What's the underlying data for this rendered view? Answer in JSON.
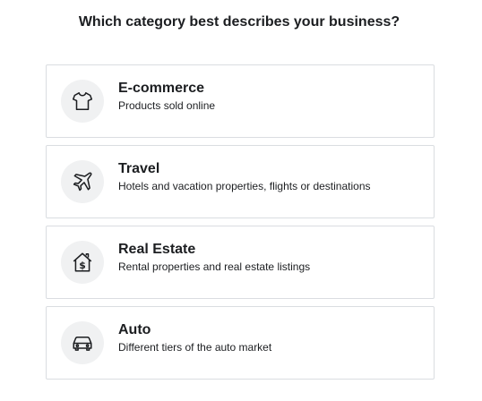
{
  "question": "Which category best describes your business?",
  "options": [
    {
      "title": "E-commerce",
      "description": "Products sold online",
      "icon": "t-shirt-icon"
    },
    {
      "title": "Travel",
      "description": "Hotels and vacation properties, flights or destinations",
      "icon": "airplane-icon"
    },
    {
      "title": "Real Estate",
      "description": "Rental properties and real estate listings",
      "icon": "house-dollar-icon"
    },
    {
      "title": "Auto",
      "description": "Different tiers of the auto market",
      "icon": "car-icon"
    }
  ],
  "colors": {
    "text": "#1c1e21",
    "border": "#dadde1",
    "icon_bg": "#f0f1f2"
  }
}
